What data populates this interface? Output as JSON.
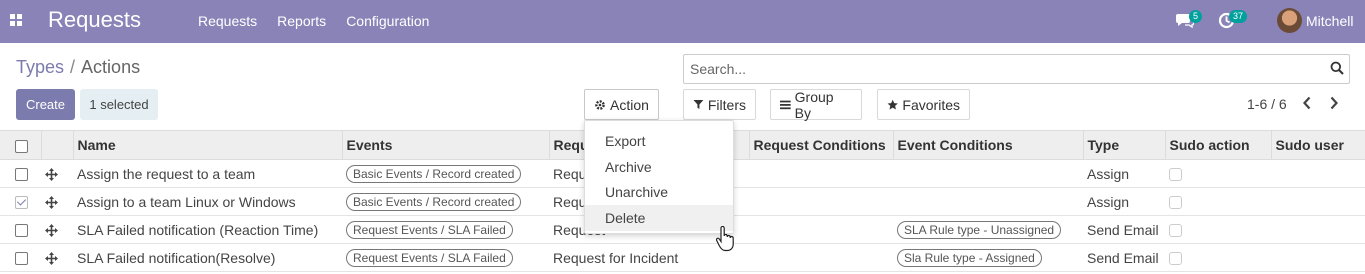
{
  "navbar": {
    "app_title": "Requests",
    "menu": [
      "Requests",
      "Reports",
      "Configuration"
    ],
    "messages_badge": "5",
    "activities_badge": "37",
    "user_name": "Mitchell",
    "bg_color": "#8a83b8"
  },
  "breadcrumb": {
    "parent": "Types",
    "current": "Actions"
  },
  "toolbar": {
    "create_label": "Create",
    "selected_label": "1 selected",
    "action_label": "Action",
    "filters_label": "Filters",
    "group_by_label": "Group By",
    "favorites_label": "Favorites",
    "accent_color": "#7c7bad"
  },
  "search": {
    "placeholder": "Search...",
    "value": ""
  },
  "pager": {
    "label": "1-6 / 6"
  },
  "action_menu": {
    "items": [
      "Export",
      "Archive",
      "Unarchive",
      "Delete"
    ],
    "hovered": "Delete"
  },
  "table": {
    "columns": [
      "Name",
      "Events",
      "Request Types",
      "Request Conditions",
      "Event Conditions",
      "Type",
      "Sudo action",
      "Sudo user"
    ],
    "rows": [
      {
        "selected": false,
        "name": "Assign the request to a team",
        "event": "Basic Events / Record created",
        "request_type": "Request",
        "event_condition": "",
        "type": "Assign",
        "sudo_action": false
      },
      {
        "selected": true,
        "name": "Assign to a team Linux or Windows",
        "event": "Basic Events / Record created",
        "request_type": "Request",
        "event_condition": "",
        "type": "Assign",
        "sudo_action": false
      },
      {
        "selected": false,
        "name": "SLA Failed notification (Reaction Time)",
        "event": "Request Events / SLA Failed",
        "request_type": "Request",
        "event_condition": "SLA Rule type - Unassigned",
        "type": "Send Email",
        "sudo_action": false
      },
      {
        "selected": false,
        "name": "SLA Failed notification(Resolve)",
        "event": "Request Events / SLA Failed",
        "request_type": "Request for Incident",
        "event_condition": "Sla Rule type - Assigned",
        "type": "Send Email",
        "sudo_action": false
      }
    ]
  }
}
